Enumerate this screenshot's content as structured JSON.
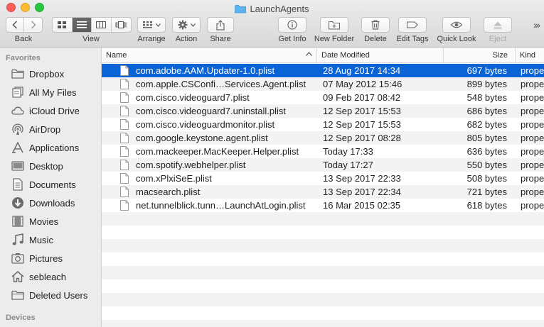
{
  "window": {
    "title": "LaunchAgents"
  },
  "toolbar": {
    "back_label": "Back",
    "view_label": "View",
    "arrange_label": "Arrange",
    "action_label": "Action",
    "share_label": "Share",
    "get_info_label": "Get Info",
    "new_folder_label": "New Folder",
    "delete_label": "Delete",
    "edit_tags_label": "Edit Tags",
    "quick_look_label": "Quick Look",
    "eject_label": "Eject",
    "active_view": "list",
    "accent": "#0a64d6"
  },
  "sidebar": {
    "favorites_header": "Favorites",
    "devices_header": "Devices",
    "items": [
      {
        "label": "Dropbox",
        "icon": "folder-icon"
      },
      {
        "label": "All My Files",
        "icon": "all-files-icon"
      },
      {
        "label": "iCloud Drive",
        "icon": "cloud-icon"
      },
      {
        "label": "AirDrop",
        "icon": "airdrop-icon"
      },
      {
        "label": "Applications",
        "icon": "applications-icon"
      },
      {
        "label": "Desktop",
        "icon": "desktop-icon"
      },
      {
        "label": "Documents",
        "icon": "documents-icon"
      },
      {
        "label": "Downloads",
        "icon": "downloads-icon"
      },
      {
        "label": "Movies",
        "icon": "movies-icon"
      },
      {
        "label": "Music",
        "icon": "music-icon"
      },
      {
        "label": "Pictures",
        "icon": "pictures-icon"
      },
      {
        "label": "sebleach",
        "icon": "home-icon"
      },
      {
        "label": "Deleted Users",
        "icon": "folder-icon"
      }
    ]
  },
  "columns": {
    "name": "Name",
    "date": "Date Modified",
    "size": "Size",
    "kind": "Kind"
  },
  "files": [
    {
      "name": "com.adobe.AAM.Updater-1.0.plist",
      "date": "28 Aug 2017 14:34",
      "size": "697 bytes",
      "kind": "prope",
      "selected": true
    },
    {
      "name": "com.apple.CSConfi…Services.Agent.plist",
      "date": "07 May 2012 15:46",
      "size": "899 bytes",
      "kind": "prope"
    },
    {
      "name": "com.cisco.videoguard7.plist",
      "date": "09 Feb 2017 08:42",
      "size": "548 bytes",
      "kind": "prope"
    },
    {
      "name": "com.cisco.videoguard7.uninstall.plist",
      "date": "12 Sep 2017 15:53",
      "size": "686 bytes",
      "kind": "prope"
    },
    {
      "name": "com.cisco.videoguardmonitor.plist",
      "date": "12 Sep 2017 15:53",
      "size": "682 bytes",
      "kind": "prope"
    },
    {
      "name": "com.google.keystone.agent.plist",
      "date": "12 Sep 2017 08:28",
      "size": "805 bytes",
      "kind": "prope"
    },
    {
      "name": "com.mackeeper.MacKeeper.Helper.plist",
      "date": "Today 17:33",
      "size": "636 bytes",
      "kind": "prope"
    },
    {
      "name": "com.spotify.webhelper.plist",
      "date": "Today 17:27",
      "size": "550 bytes",
      "kind": "prope"
    },
    {
      "name": "com.xPlxiSeE.plist",
      "date": "13 Sep 2017 22:33",
      "size": "508 bytes",
      "kind": "prope"
    },
    {
      "name": "macsearch.plist",
      "date": "13 Sep 2017 22:34",
      "size": "721 bytes",
      "kind": "prope"
    },
    {
      "name": "net.tunnelblick.tunn…LaunchAtLogin.plist",
      "date": "16 Mar 2015 02:35",
      "size": "618 bytes",
      "kind": "prope"
    }
  ]
}
